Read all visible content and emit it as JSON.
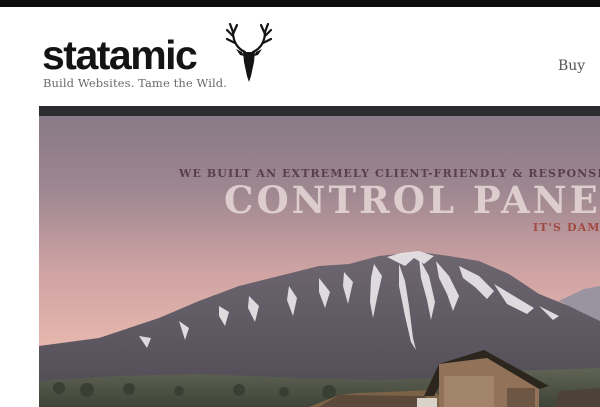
{
  "header": {
    "brand": "statamic",
    "tagline": "Build Websites. Tame the Wild.",
    "logo_icon": "deer-antlers-icon"
  },
  "nav": {
    "buy_label": "Buy"
  },
  "hero": {
    "line1": "WE BUILT AN EXTREMELY CLIENT-FRIENDLY & RESPONSIVE",
    "line2": "CONTROL PANEL",
    "line3": "IT'S DAMN",
    "scene": "mountain-barn-landscape"
  },
  "colors": {
    "top_bar": "#0d0d0d",
    "brand_text": "#141414",
    "tagline_text": "#6a6a6a",
    "hero_line1": "#5a3f48",
    "hero_line2": "#e8d9d8",
    "hero_line3": "#a24a42"
  }
}
